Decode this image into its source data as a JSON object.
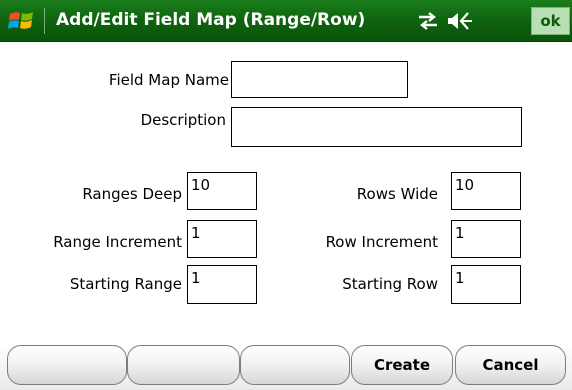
{
  "titlebar": {
    "title": "Add/Edit Field Map (Range/Row)",
    "ok_label": "ok",
    "start_icon": "windows-start-icon",
    "connectivity_icon": "connectivity-icon",
    "volume_icon": "volume-icon",
    "background_color": "#0e610e"
  },
  "form": {
    "field_map_name": {
      "label": "Field Map Name",
      "value": ""
    },
    "description": {
      "label": "Description",
      "value": ""
    },
    "ranges_deep": {
      "label": "Ranges Deep",
      "value": "10"
    },
    "rows_wide": {
      "label": "Rows Wide",
      "value": "10"
    },
    "range_increment": {
      "label": "Range Increment",
      "value": "1"
    },
    "row_increment": {
      "label": "Row Increment",
      "value": "1"
    },
    "starting_range": {
      "label": "Starting Range",
      "value": "1"
    },
    "starting_row": {
      "label": "Starting Row",
      "value": "1"
    }
  },
  "softkeys": {
    "blank1": "",
    "blank2": "",
    "blank3": "",
    "create": "Create",
    "cancel": "Cancel"
  }
}
